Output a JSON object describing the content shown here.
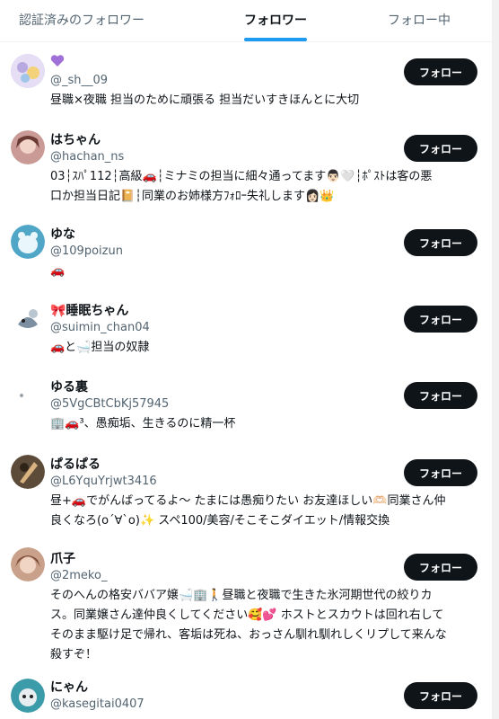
{
  "tabs": [
    {
      "label": "認証済みのフォロワー",
      "active": false
    },
    {
      "label": "フォロワー",
      "active": true
    },
    {
      "label": "フォロー中",
      "active": false
    }
  ],
  "follow_label": "フォロー",
  "users": [
    {
      "name": "",
      "handle": "@_sh__09",
      "bio": [
        "昼職×夜職 担当のために頑張る 担当だいすきほんとに大切"
      ]
    },
    {
      "name": "はちゃん",
      "handle": "@hachan_ns",
      "bio": [
        "03┆ｽﾊﾟ112┆高級🚗┆ミナミの担当に細々通ってます👨🏻🤍┆ﾎﾟｽﾄは客の悪",
        "口か担当日記📔┆同業のお姉様方ﾌｫﾛｰ失礼します👩🏻👑"
      ]
    },
    {
      "name": "ゆな",
      "handle": "@109poizun",
      "bio": [
        "🚗"
      ]
    },
    {
      "name": "🎀睡眠ちゃん",
      "handle": "@suimin_chan04",
      "bio": [
        "🚗と🛁担当の奴隷"
      ]
    },
    {
      "name": "ゆる裏",
      "handle": "@5VgCBtCbKj57945",
      "bio": [
        "🏢🚗³、愚痴垢、生きるのに精一杯"
      ]
    },
    {
      "name": "ぱるぱる",
      "handle": "@L6YquYrjwt3416",
      "bio": [
        "昼+🚗でがんばってるよ〜 たまには愚痴りたい お友達ほしい🫶🏻同業さん仲",
        "良くなろ(o´∀`o)✨ スペ100/美容/そこそこダイエット/情報交換"
      ]
    },
    {
      "name": "爪子",
      "handle": "@2meko_",
      "bio": [
        "そのへんの格安ババア嬢🛁🏢🚶昼職と夜職で生きた氷河期世代の絞りカ",
        "ス。同業嬢さん達仲良くしてください🥰💕 ホストとスカウトは回れ右して",
        "そのまま駆け足で帰れ、客垢は死ね、おっさん馴れ馴れしくリプして来んな",
        "殺すぞ！"
      ]
    },
    {
      "name": "にゃん",
      "handle": "@kasegitai0407",
      "bio": []
    }
  ]
}
